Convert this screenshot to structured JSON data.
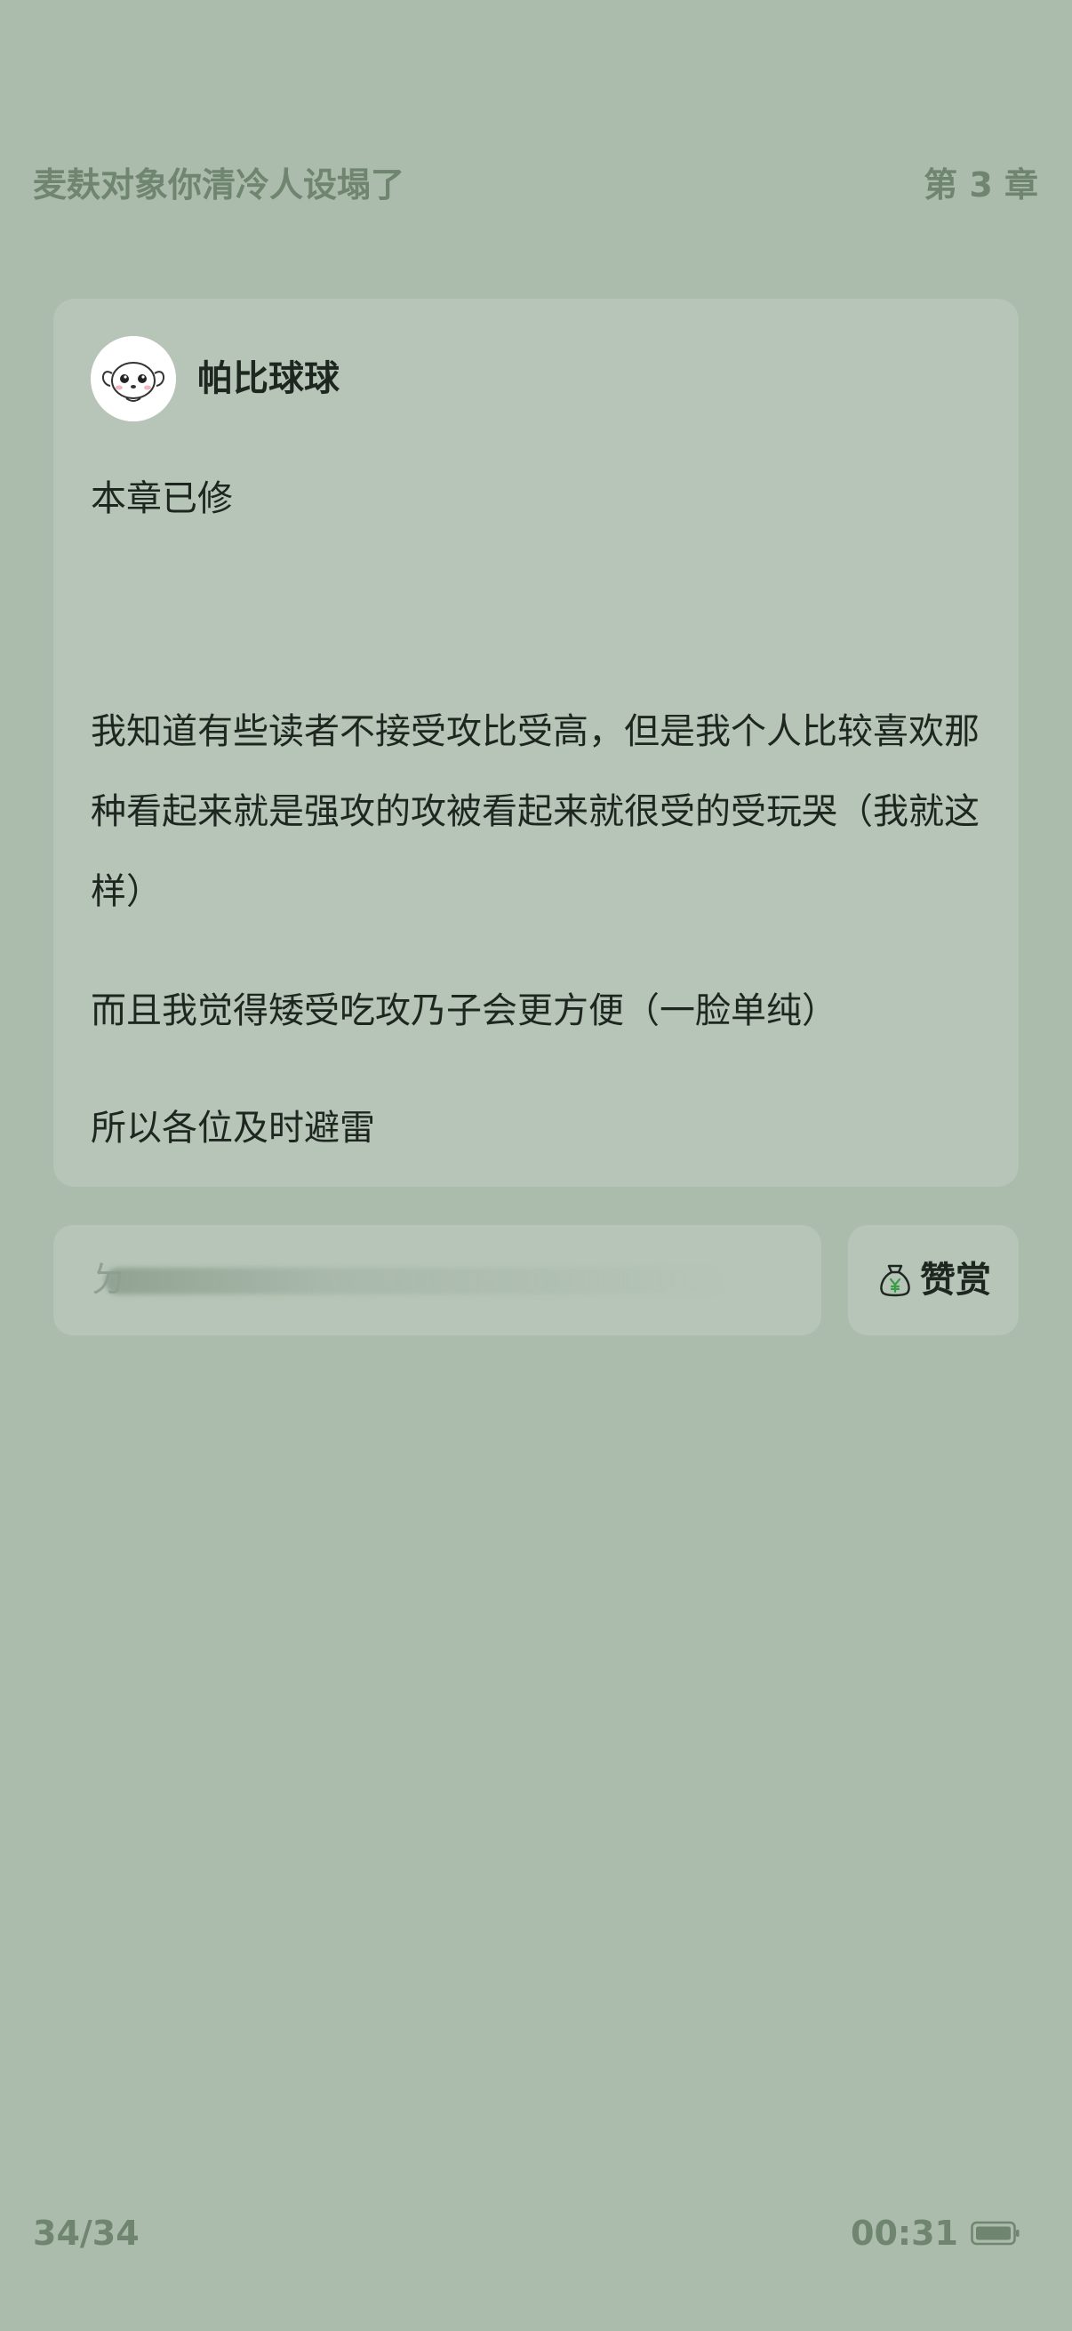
{
  "header": {
    "book_title": "麦麸对象你清冷人设塌了",
    "chapter": "第 3 章"
  },
  "author_note": {
    "avatar_icon": "cartoon-dog-avatar",
    "author_name": "帕比球球",
    "paragraphs": [
      "本章已修",
      "我知道有些读者不接受攻比受高，但是我个人比较喜欢那种看起来就是强攻的攻被看起来就很受的受玩哭（我就这样）",
      "而且我觉得矮受吃攻乃子会更方便（一脸单纯）",
      "所以各位及时避雷"
    ]
  },
  "comment_bar": {
    "placeholder": "ㄉ"
  },
  "reward_button": {
    "icon": "money-bag-icon",
    "label": "赞赏",
    "icon_color": "#3a9d4a"
  },
  "footer": {
    "page_progress": "34/34",
    "time": "00:31",
    "battery_icon": "battery-icon"
  },
  "colors": {
    "background": "#abbbac",
    "card": "#b6c5b7",
    "muted_text": "#6f8570",
    "text": "#1e2620"
  }
}
